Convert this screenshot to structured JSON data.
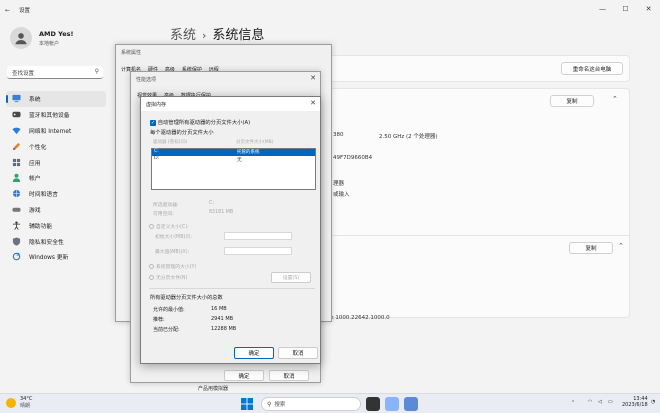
{
  "settings": {
    "app_title": "设置",
    "window_controls": [
      "—",
      "☐",
      "✕"
    ],
    "profile": {
      "name": "AMD Yes!",
      "sub": "本地帐户"
    },
    "search_placeholder": "查找设置",
    "nav": [
      {
        "label": "系统",
        "icon": "monitor-icon",
        "active": true
      },
      {
        "label": "蓝牙和其他设备",
        "icon": "bluetooth-icon"
      },
      {
        "label": "网络和 Internet",
        "icon": "wifi-icon"
      },
      {
        "label": "个性化",
        "icon": "brush-icon"
      },
      {
        "label": "应用",
        "icon": "apps-icon"
      },
      {
        "label": "帐户",
        "icon": "person-icon"
      },
      {
        "label": "时间和语言",
        "icon": "globe-icon"
      },
      {
        "label": "游戏",
        "icon": "gamepad-icon"
      },
      {
        "label": "辅助功能",
        "icon": "accessibility-icon"
      },
      {
        "label": "隐私和安全性",
        "icon": "shield-icon"
      },
      {
        "label": "Windows 更新",
        "icon": "update-icon"
      }
    ],
    "breadcrumb": {
      "parent": "系统",
      "current": "系统信息"
    },
    "rename_button": "重命名这台电脑",
    "copy_button": "复制",
    "copy_button_2": "复制",
    "spec_frag_1": "380",
    "spec_cpu": "2.50 GHz  (2 个处理器)",
    "spec_id": "49F7D9660B4",
    "spec_frag_2": "理器",
    "spec_frag_3": "或输入",
    "spec_experience": "Pack 1000.22642.1000.0"
  },
  "sysprops": {
    "title": "系统属性",
    "tabs": [
      "计算机名",
      "硬件",
      "高级",
      "系统保护",
      "远程"
    ]
  },
  "perf": {
    "title": "性能选项",
    "tabs": [
      "视觉效果",
      "高级",
      "数据执行保护"
    ],
    "ok": "确定",
    "cancel": "取消",
    "bottom_frag": "产品用模拟器"
  },
  "vm": {
    "title": "虚拟内存",
    "auto_manage": "自动管理所有驱动器的分页文件大小(A)",
    "each_drive": "每个驱动器的分页文件大小",
    "col_drive": "驱动器 [卷标](D)",
    "col_size": "分页文件大小(MB)",
    "drives": [
      {
        "drive": "C:",
        "size": "托管的系统"
      },
      {
        "drive": "D:",
        "size": "无"
      }
    ],
    "selected_drive_label": "所选驱动器:",
    "selected_drive_value": "C:",
    "space_label": "可用空间:",
    "space_value": "83181 MB",
    "custom_size": "自定义大小(C):",
    "initial": "初始大小(MB)(I):",
    "max": "最大值(MB)(X):",
    "system_managed": "系统管理的大小(Y)",
    "no_paging": "无分页文件(N)",
    "set_button": "设置(S)",
    "total_header": "所有驱动器分页文件大小的总数",
    "min_label": "允许的最小值:",
    "min_value": "16 MB",
    "rec_label": "推荐:",
    "rec_value": "2941 MB",
    "cur_label": "当前已分配:",
    "cur_value": "12288 MB",
    "ok": "确定",
    "cancel": "取消"
  },
  "taskbar": {
    "weather_temp": "34°C",
    "weather_desc": "晴朗",
    "search_placeholder": "搜索",
    "time": "13:44",
    "date": "2023/6/18"
  }
}
